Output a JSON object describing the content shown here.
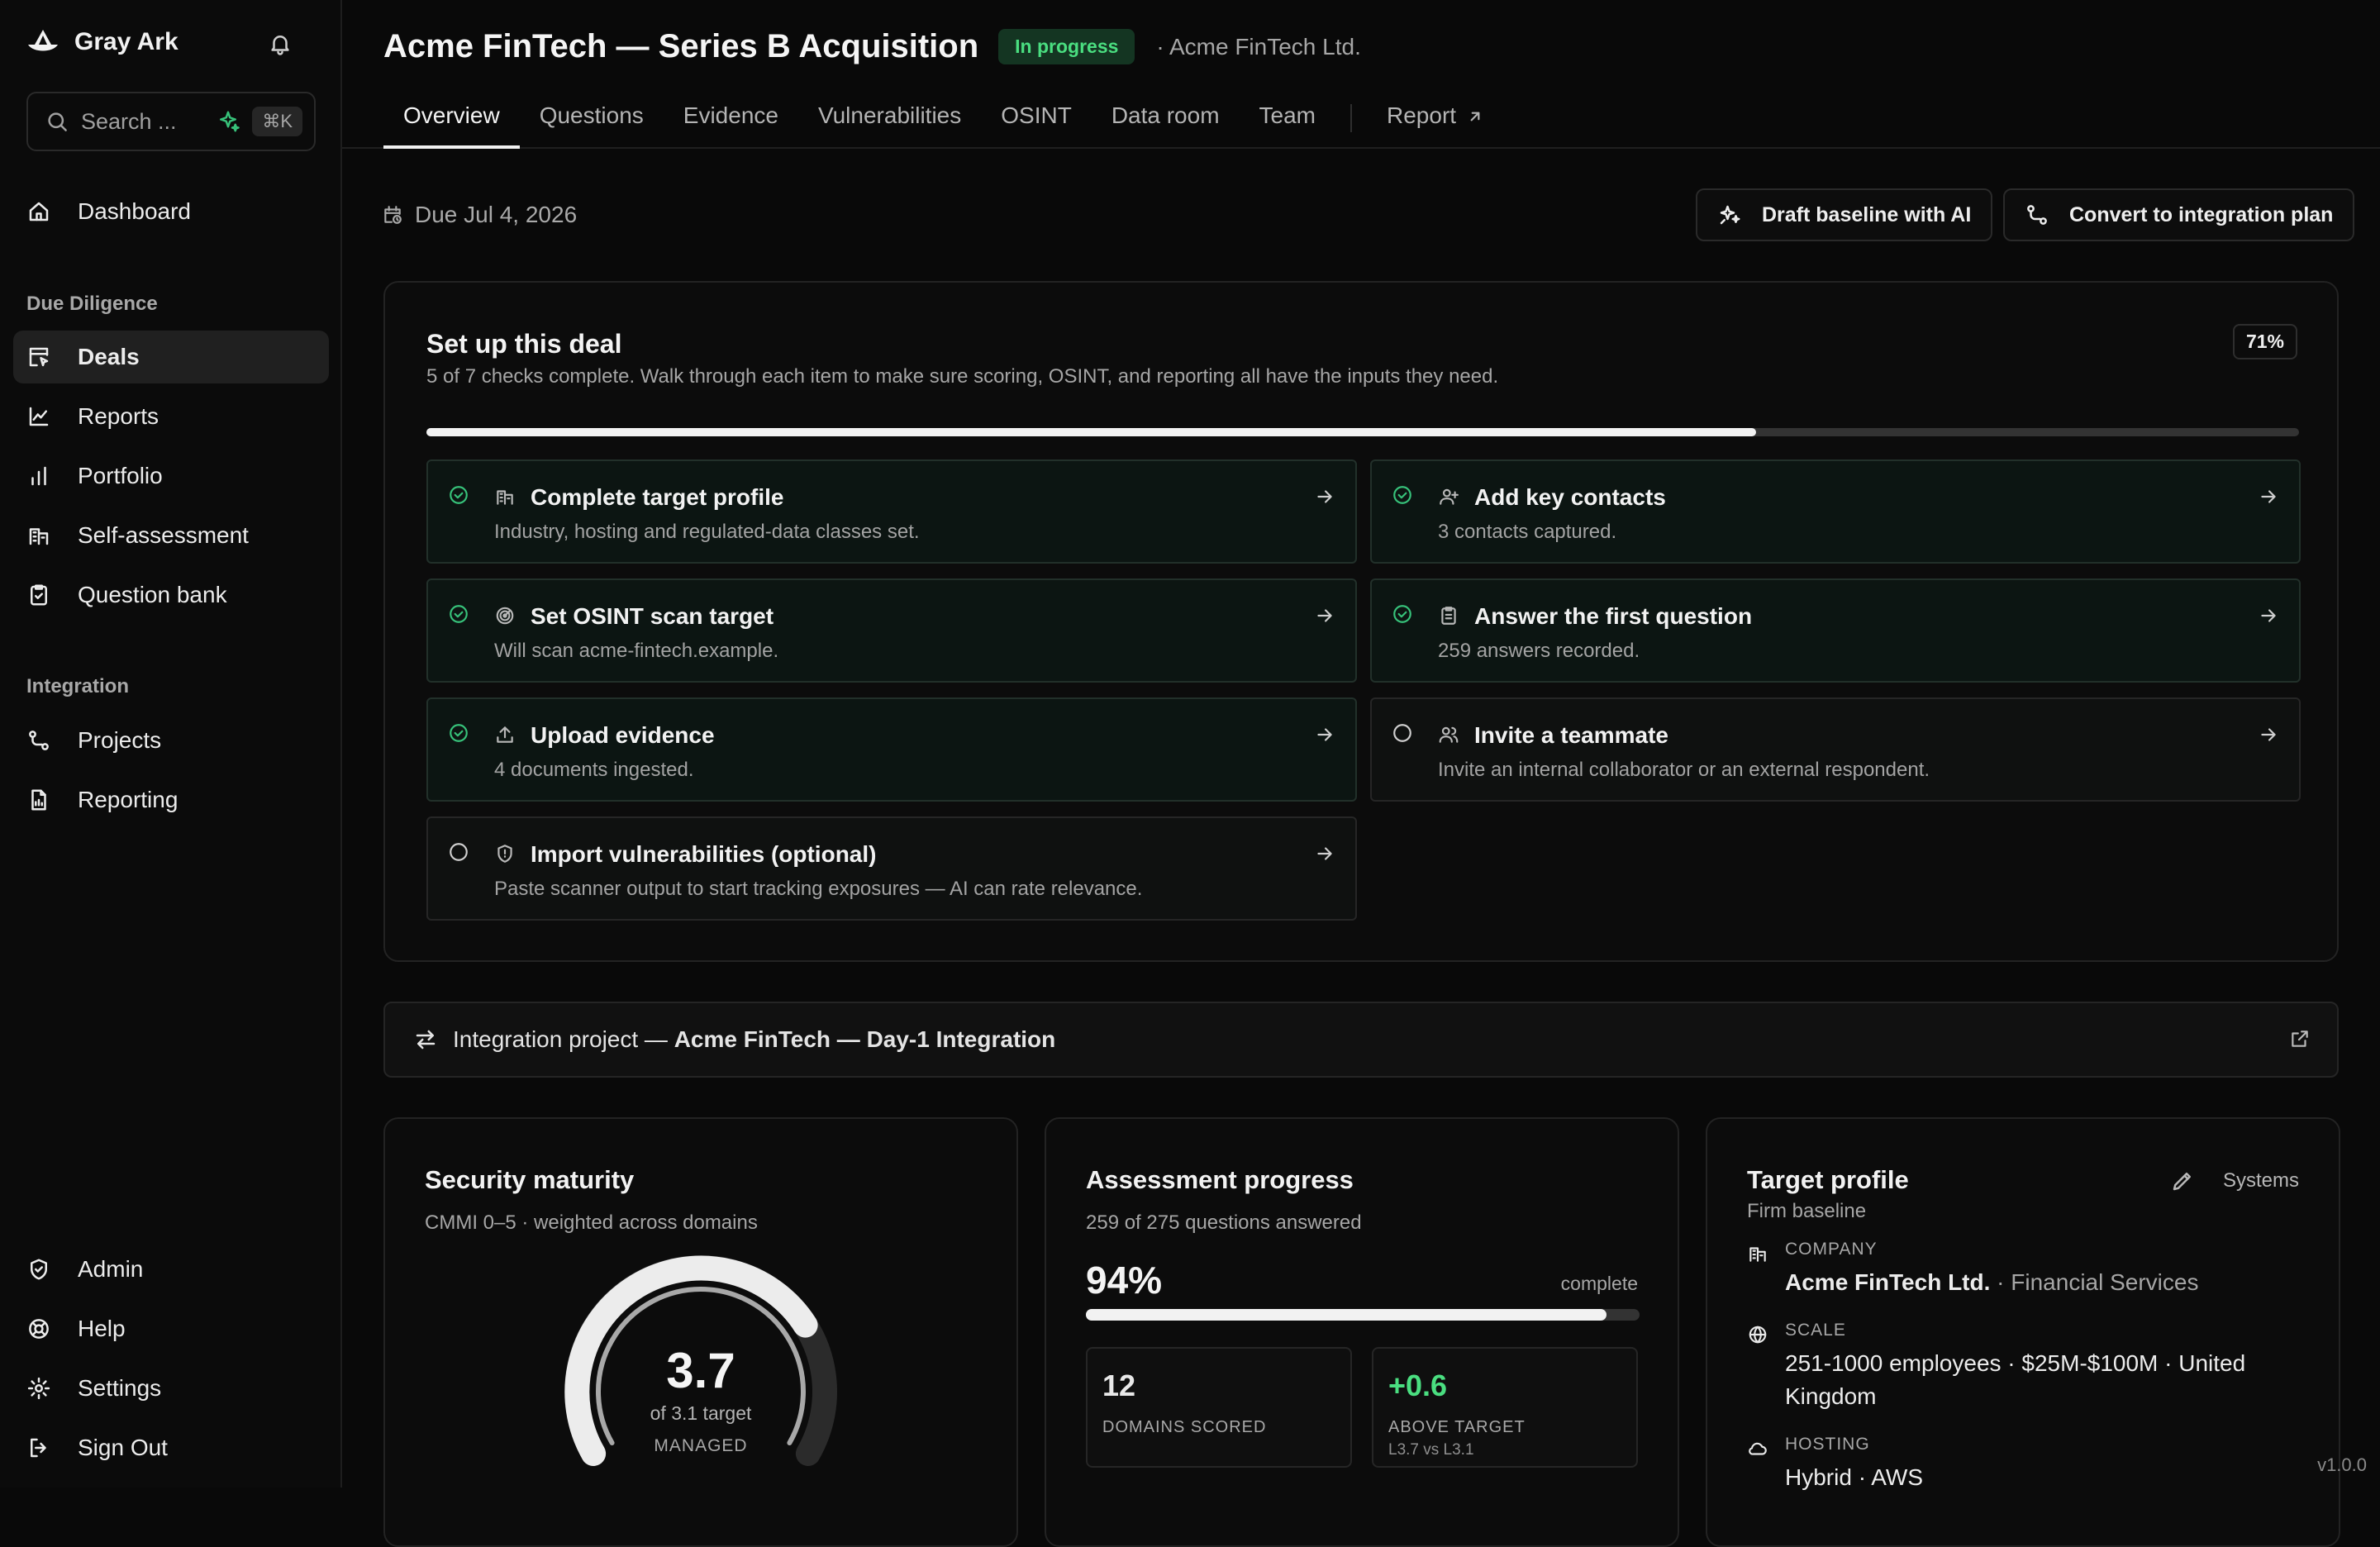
{
  "app": {
    "name": "Gray Ark",
    "version": "v1.0.0"
  },
  "search": {
    "placeholder": "Search ...",
    "shortcut": "⌘K"
  },
  "sidebar": {
    "dashboard": "Dashboard",
    "section_dd": "Due Diligence",
    "dd_items": [
      "Deals",
      "Reports",
      "Portfolio",
      "Self-assessment",
      "Question bank"
    ],
    "section_integration": "Integration",
    "integration_items": [
      "Projects",
      "Reporting"
    ],
    "footer_items": [
      "Admin",
      "Help",
      "Settings",
      "Sign Out"
    ]
  },
  "header": {
    "title": "Acme FinTech — Series B Acquisition",
    "status": "In progress",
    "company": "· Acme FinTech Ltd.",
    "tabs": [
      "Overview",
      "Questions",
      "Evidence",
      "Vulnerabilities",
      "OSINT",
      "Data room",
      "Team"
    ],
    "report_tab": "Report"
  },
  "toolbar": {
    "due": "Due Jul 4, 2026",
    "draft_ai": "Draft baseline with AI",
    "convert": "Convert to integration plan"
  },
  "setup": {
    "title": "Set up this deal",
    "subtitle": "5 of 7 checks complete. Walk through each item to make sure scoring, OSINT, and reporting all have the inputs they need.",
    "percent_label": "71%",
    "progress": 0.71,
    "checks": [
      {
        "title": "Complete target profile",
        "desc": "Industry, hosting and regulated-data classes set.",
        "done": true,
        "icon": "building-icon"
      },
      {
        "title": "Add key contacts",
        "desc": "3 contacts captured.",
        "done": true,
        "icon": "user-plus-icon"
      },
      {
        "title": "Set OSINT scan target",
        "desc": "Will scan acme-fintech.example.",
        "done": true,
        "icon": "radar-icon"
      },
      {
        "title": "Answer the first question",
        "desc": "259 answers recorded.",
        "done": true,
        "icon": "clipboard-icon"
      },
      {
        "title": "Upload evidence",
        "desc": "4 documents ingested.",
        "done": true,
        "icon": "upload-icon"
      },
      {
        "title": "Invite a teammate",
        "desc": "Invite an internal collaborator or an external respondent.",
        "done": false,
        "icon": "users-icon"
      },
      {
        "title": "Import vulnerabilities (optional)",
        "desc": "Paste scanner output to start tracking exposures — AI can rate relevance.",
        "done": false,
        "icon": "shield-icon"
      }
    ]
  },
  "integration": {
    "prefix": "Integration project — ",
    "name": "Acme FinTech — Day-1 Integration"
  },
  "maturity": {
    "title": "Security maturity",
    "subtitle": "CMMI 0–5 · weighted across domains",
    "score": "3.7",
    "score_value": 3.7,
    "max": 5,
    "target": "of 3.1 target",
    "level": "MANAGED"
  },
  "assessment": {
    "title": "Assessment progress",
    "subtitle": "259 of 275 questions answered",
    "percent": "94%",
    "progress": 0.94,
    "complete_label": "complete",
    "stat1_value": "12",
    "stat1_label": "DOMAINS SCORED",
    "stat2_value": "+0.6",
    "stat2_label": "ABOVE TARGET",
    "stat2_sub": "L3.7 vs L3.1"
  },
  "target_profile": {
    "title": "Target profile",
    "subtitle": "Firm baseline",
    "systems_label": "Systems",
    "company_label": "COMPANY",
    "company_name": "Acme FinTech Ltd.",
    "company_industry": "· Financial Services",
    "scale_label": "SCALE",
    "scale_value": "251-1000 employees · $25M-$100M · United Kingdom",
    "hosting_label": "HOSTING",
    "hosting_value": "Hybrid · AWS"
  },
  "colors": {
    "accent_green": "#4ade80",
    "check_green": "#37c27a",
    "background": "#090909"
  }
}
